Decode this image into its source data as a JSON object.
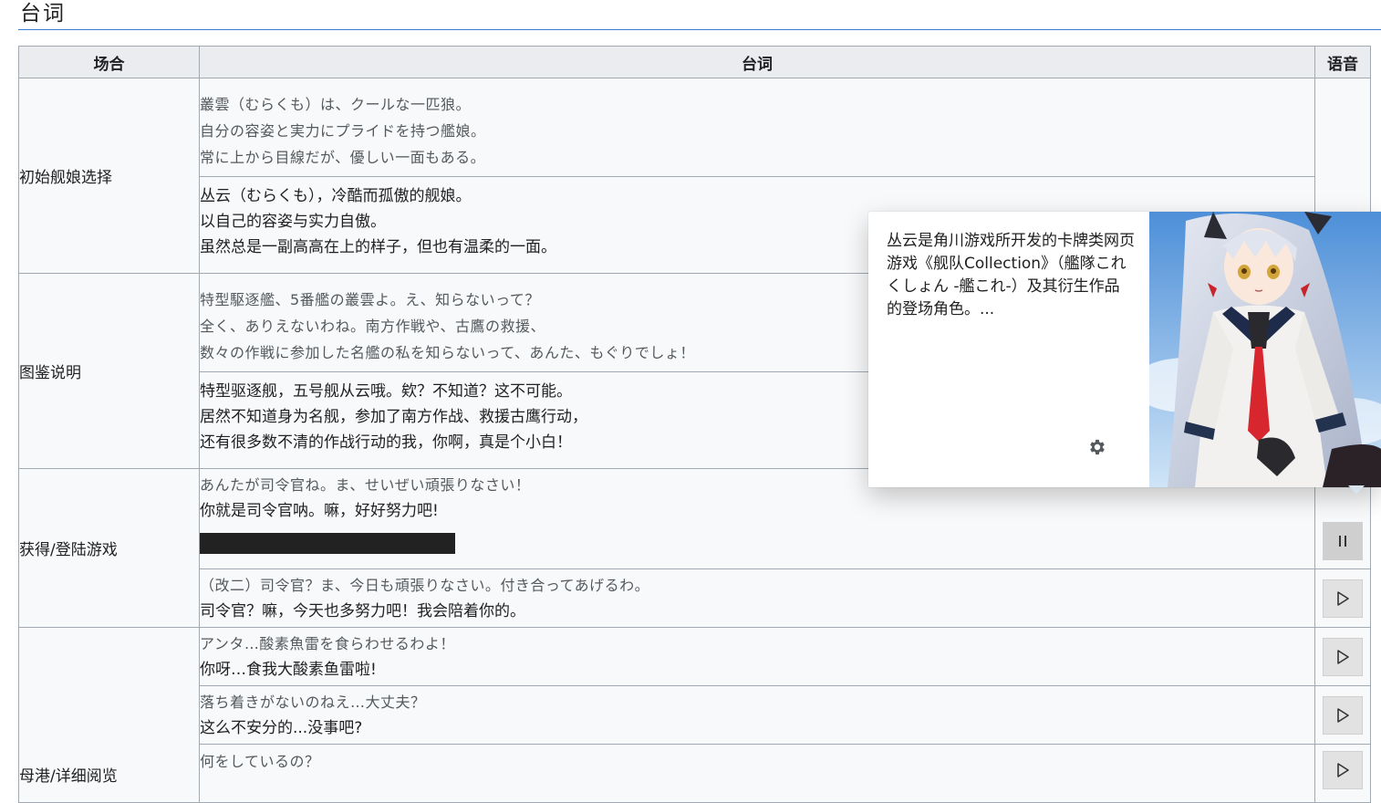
{
  "section_title": "台词",
  "table": {
    "headers": {
      "occasion": "场合",
      "lines": "台词",
      "voice": "语音"
    },
    "rows": [
      {
        "occasion": "初始舰娘选择",
        "ja": [
          "叢雲（むらくも）は、クールな一匹狼。",
          "自分の容姿と実力にプライドを持つ艦娘。",
          "常に上から目線だが、優しい一面もある。"
        ],
        "zh": [
          "丛云（むらくも），冷酷而孤傲的舰娘。",
          "以自己的容姿与实力自傲。",
          "虽然总是一副高高在上的样子，但也有温柔的一面。"
        ]
      },
      {
        "occasion": "图鉴说明",
        "ja": [
          "特型駆逐艦、5番艦の叢雲よ。え、知らないって？",
          "全く、ありえないわね。南方作戦や、古鷹の救援、",
          "数々の作戦に参加した名艦の私を知らないって、あんた、もぐりでしょ！"
        ],
        "zh": [
          "特型驱逐舰，五号舰从云哦。欸？不知道？这不可能。",
          "居然不知道身为名舰，参加了南方作战、救援古鹰行动，",
          "还有很多数不清的作战行动的我，你啊，真是个小白！"
        ]
      },
      {
        "occasion": "获得/登陆游戏",
        "subrows": [
          {
            "ja": "あんたが司令官ね。ま、せいぜい頑張りなさい！",
            "zh": "你就是司令官呐。嘛，好好努力吧!",
            "voice": "pause"
          },
          {
            "ja": "（改二）司令官？ま、今日も頑張りなさい。付き合ってあげるわ。",
            "zh": "司令官？嘛，今天也多努力吧！我会陪着你的。",
            "voice": "play"
          }
        ]
      },
      {
        "occasion": "母港/详细阅览",
        "subrows": [
          {
            "ja": "アンタ…酸素魚雷を食らわせるわよ！",
            "zh": "你呀…食我大酸素鱼雷啦!",
            "voice": "play"
          },
          {
            "ja": "落ち着きがないのねえ…大丈夫？",
            "zh": "这么不安分的...没事吧?",
            "voice": "play"
          },
          {
            "ja": "何をしているの？",
            "zh": "",
            "voice": "play"
          }
        ]
      }
    ]
  },
  "popup": {
    "summary": "丛云是角川游戏所开发的卡牌类网页游戏《舰队Collection》（艦隊これくしょん -艦これ-）及其衍生作品的登场角色。...",
    "settings_icon": "gear-icon",
    "image": "character-illustration"
  },
  "icons": {
    "play": "play-icon",
    "pause": "pause-icon"
  },
  "colors": {
    "heading_rule": "#3a7bd5",
    "header_bg": "#eaecf0",
    "border": "#a2a9b1",
    "button_bg": "#e2e2e2"
  }
}
